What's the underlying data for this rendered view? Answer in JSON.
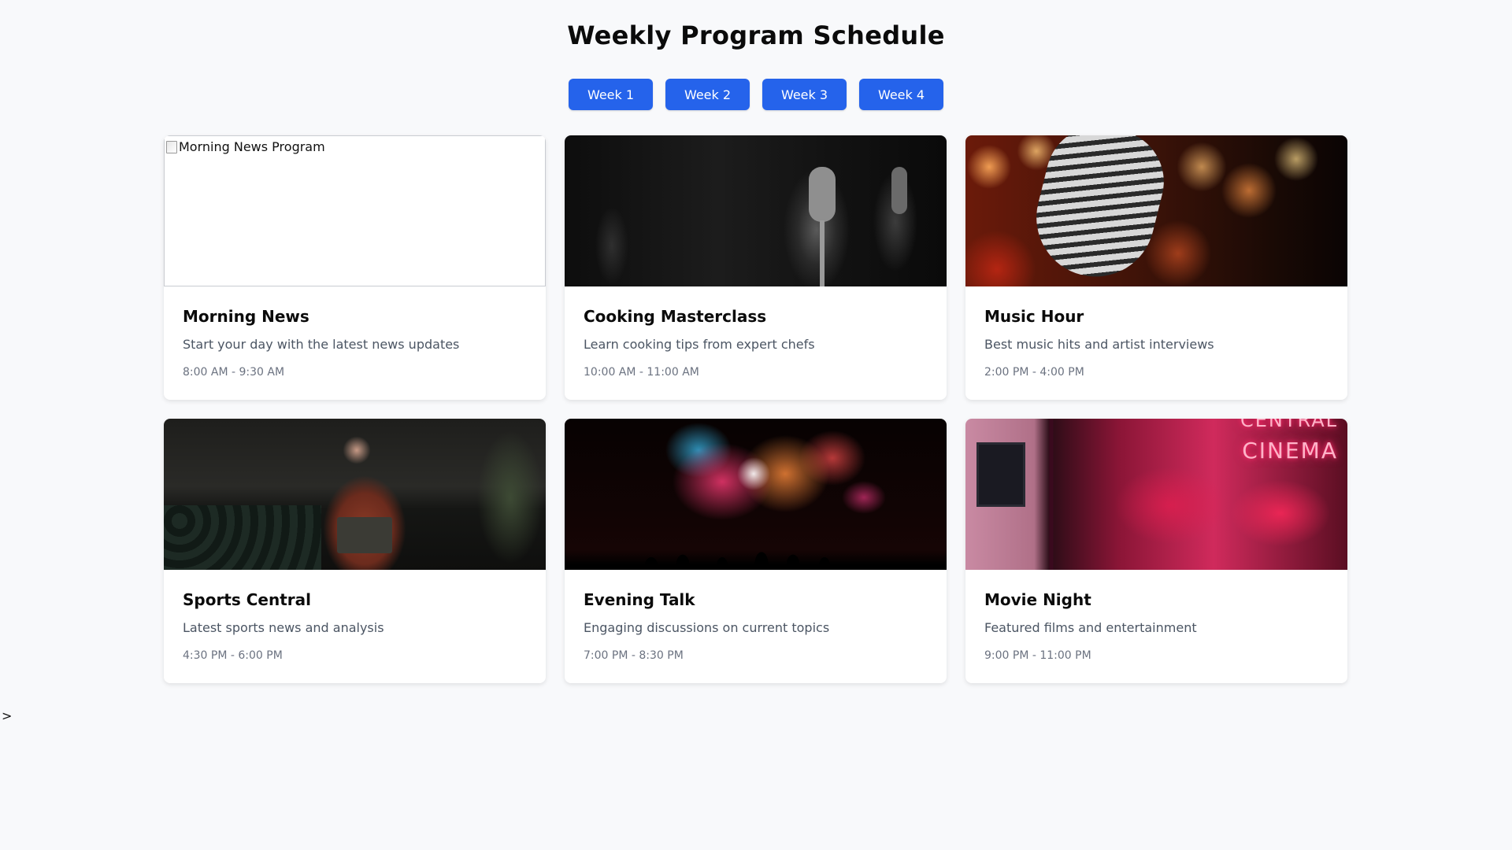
{
  "page": {
    "title": "Weekly Program Schedule",
    "stray_text": ">"
  },
  "weeks": [
    {
      "label": "Week 1"
    },
    {
      "label": "Week 2"
    },
    {
      "label": "Week 3"
    },
    {
      "label": "Week 4"
    }
  ],
  "programs": [
    {
      "title": "Morning News",
      "description": "Start your day with the latest news updates",
      "time": "8:00 AM - 9:30 AM",
      "image_alt": "Morning News Program",
      "image_broken": true
    },
    {
      "title": "Cooking Masterclass",
      "description": "Learn cooking tips from expert chefs",
      "time": "10:00 AM - 11:00 AM"
    },
    {
      "title": "Music Hour",
      "description": "Best music hits and artist interviews",
      "time": "2:00 PM - 4:00 PM"
    },
    {
      "title": "Sports Central",
      "description": "Latest sports news and analysis",
      "time": "4:30 PM - 6:00 PM"
    },
    {
      "title": "Evening Talk",
      "description": "Engaging discussions on current topics",
      "time": "7:00 PM - 8:30 PM"
    },
    {
      "title": "Movie Night",
      "description": "Featured films and entertainment",
      "time": "9:00 PM - 11:00 PM",
      "image_sign_text": "CINEMA",
      "image_sign_text_top": "CENTRAL"
    }
  ],
  "colors": {
    "accent": "#2563eb",
    "background": "#f8f9fb",
    "description_text": "#4b5563",
    "time_text": "#6b7280"
  }
}
